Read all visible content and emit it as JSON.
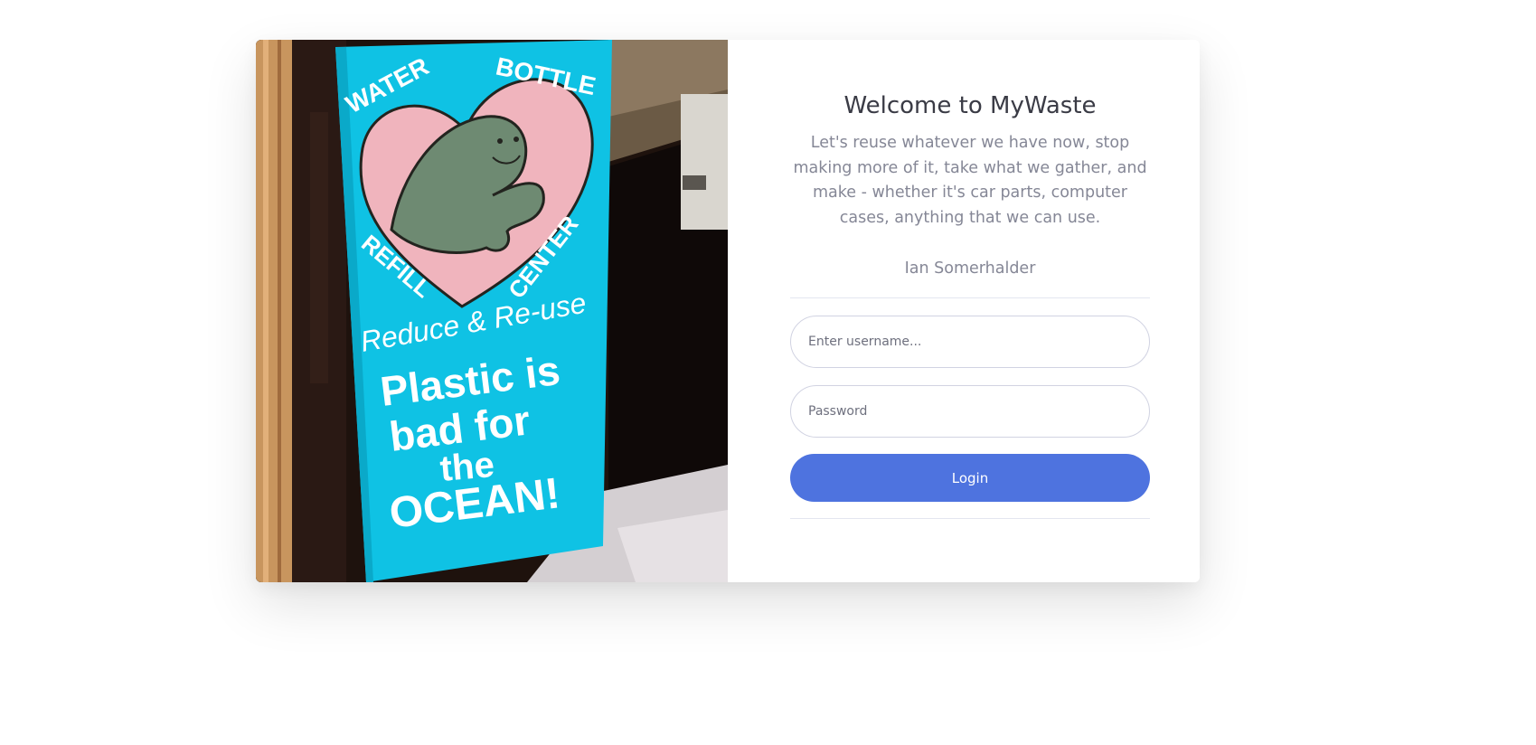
{
  "hero": {
    "image_alt": "Hand-painted sign with a manatee in a heart",
    "sign_text": {
      "top_left": "WATER",
      "top_right": "BOTTLE",
      "refill": "REFILL",
      "center": "CENTER",
      "reduce": "Reduce & Re-use",
      "line1": "Plastic is",
      "line2": "bad for",
      "line3": "the",
      "line4": "OCEAN!"
    }
  },
  "login": {
    "title": "Welcome to MyWaste",
    "quote": "Let's reuse whatever we have now, stop making more of it, take what we gather, and make - whether it's car parts, computer cases, anything that we can use.",
    "author": "Ian Somerhalder",
    "username_placeholder": "Enter username...",
    "username_value": "",
    "password_placeholder": "Password",
    "password_value": "",
    "login_label": "Login"
  },
  "colors": {
    "accent": "#4e73df",
    "heading": "#3a3b45",
    "muted": "#858796",
    "sign_blue": "#11c4e6",
    "heart_pink": "#f0b4bd",
    "manatee": "#6e8a72"
  }
}
